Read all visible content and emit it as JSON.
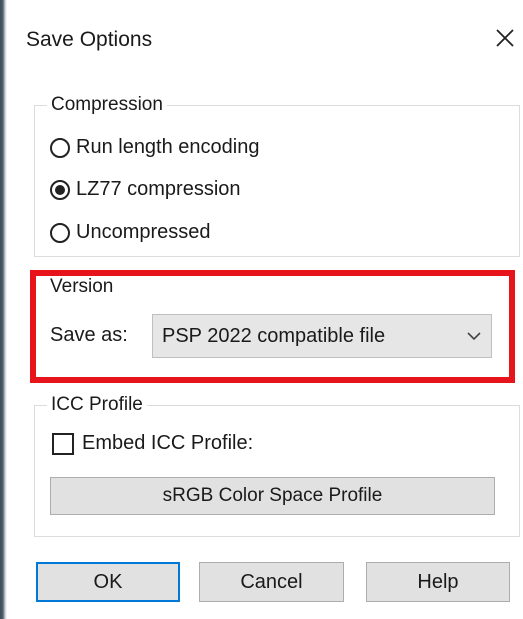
{
  "dialog": {
    "title": "Save Options",
    "close_label": "✕"
  },
  "compression": {
    "legend": "Compression",
    "options": [
      {
        "label": "Run length encoding",
        "checked": false
      },
      {
        "label": "LZ77 compression",
        "checked": true
      },
      {
        "label": "Uncompressed",
        "checked": false
      }
    ]
  },
  "version": {
    "legend": "Version",
    "save_as_label": "Save as:",
    "selected": "PSP 2022 compatible file",
    "highlight_color": "#e8141b"
  },
  "icc": {
    "legend": "ICC Profile",
    "embed_label": "Embed ICC Profile:",
    "embed_checked": false,
    "profile_button": "sRGB Color Space Profile"
  },
  "buttons": {
    "ok": "OK",
    "cancel": "Cancel",
    "help": "Help"
  },
  "colors": {
    "accent": "#0078d7",
    "button_bg": "#e1e1e1"
  }
}
